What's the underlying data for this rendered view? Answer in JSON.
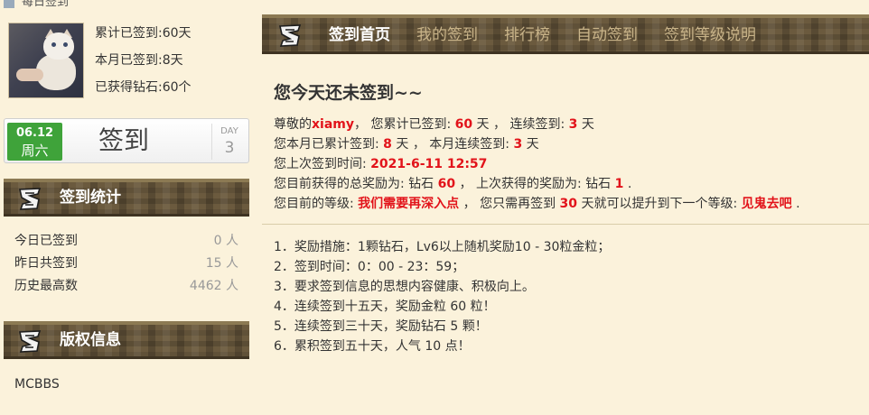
{
  "crumb": {
    "text": "每日签到"
  },
  "profile": {
    "total_label": "累计已签到:",
    "total_value": "60天",
    "month_label": "本月已签到:",
    "month_value": "8天",
    "diamond_label": "已获得钻石:",
    "diamond_value": "60个"
  },
  "sign_button": {
    "date": "06.12",
    "weekday": "周六",
    "label": "签到",
    "day_label": "DAY",
    "day_value": "3"
  },
  "stats_section": {
    "title": "签到统计",
    "rows": [
      {
        "label": "今日已签到",
        "value": "0 人"
      },
      {
        "label": "昨日共签到",
        "value": "15 人"
      },
      {
        "label": "历史最高数",
        "value": "4462 人"
      }
    ]
  },
  "copyright_section": {
    "title": "版权信息",
    "text": "MCBBS"
  },
  "tabs": [
    {
      "label": "签到首页",
      "active": true
    },
    {
      "label": "我的签到",
      "active": false
    },
    {
      "label": "排行榜",
      "active": false
    },
    {
      "label": "自动签到",
      "active": false
    },
    {
      "label": "签到等级说明",
      "active": false
    }
  ],
  "main": {
    "heading": "您今天还未签到~~",
    "line1": {
      "p1": "尊敬的",
      "username": "xiamy",
      "p2": "， 您累计已签到: ",
      "total": "60",
      "p3": " 天 ， 连续签到: ",
      "streak": "3",
      "p4": " 天"
    },
    "line2": {
      "p1": "您本月已累计签到: ",
      "month": "8",
      "p2": " 天 ， 本月连续签到: ",
      "month_streak": "3",
      "p3": " 天"
    },
    "line3": {
      "p1": "您上次签到时间: ",
      "last_time": "2021-6-11 12:57"
    },
    "line4": {
      "p1": "您目前获得的总奖励为: 钻石 ",
      "total_reward": "60",
      "p2": " ， 上次获得的奖励为: 钻石 ",
      "last_reward": "1",
      "p3": " ."
    },
    "line5": {
      "p1": "您目前的等级: ",
      "level": "我们需要再深入点",
      "p2": " ， 您只需再签到 ",
      "need": "30",
      "p3": " 天就可以提升到下一个等级: ",
      "next_level": "见鬼去吧",
      "p4": " ."
    }
  },
  "rules": [
    "1．奖励措施：1颗钻石，Lv6以上随机奖励10 - 30粒金粒；",
    "2．签到时间：0：00 - 23：59；",
    "3．要求签到信息的思想内容健康、积极向上。",
    "4．连续签到十五天，奖励金粒 60 粒！",
    "5．连续签到三十天，奖励钻石 5 颗！",
    "6．累积签到五十天，人气 10 点！"
  ],
  "colors": {
    "accent_red": "#e2131a",
    "date_green": "#3fa33a",
    "page_bg": "#fbf2db",
    "bar_brown": "#6b5a3e"
  },
  "icons": {
    "section_logo": "mcbbs-logo-icon",
    "home": "home-icon"
  }
}
